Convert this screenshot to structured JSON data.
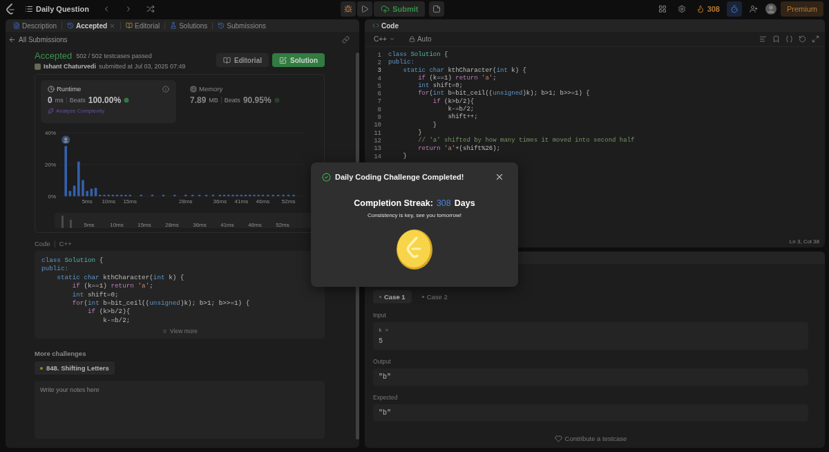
{
  "topbar": {
    "title": "Daily Question",
    "submit": "Submit",
    "streak": "308",
    "premium": "Premium"
  },
  "left_panel": {
    "tabs": [
      {
        "label": "Description",
        "selected": false,
        "closable": false,
        "kind": "description"
      },
      {
        "label": "Accepted",
        "selected": true,
        "closable": true,
        "kind": "accepted"
      },
      {
        "label": "Editorial",
        "selected": false,
        "closable": false,
        "kind": "editorial"
      },
      {
        "label": "Solutions",
        "selected": false,
        "closable": false,
        "kind": "solutions"
      },
      {
        "label": "Submissions",
        "selected": false,
        "closable": false,
        "kind": "submissions"
      }
    ],
    "back_link": "All Submissions",
    "result": {
      "status": "Accepted",
      "testcases": "502 / 502 testcases passed",
      "author": "Ishant Chaturvedi",
      "submitted": "submitted at Jul 03, 2025 07:49"
    },
    "buttons": [
      {
        "label": "Editorial",
        "kind": "secondary"
      },
      {
        "label": "Solution",
        "kind": "primary"
      }
    ],
    "metrics": [
      {
        "title": "Runtime",
        "kind": "runtime",
        "value": "0",
        "unit": "ms",
        "beats_label": "Beats",
        "beats": "100.00%",
        "selected": true
      },
      {
        "title": "Memory",
        "kind": "memory",
        "value": "7.89",
        "unit": "MB",
        "beats_label": "Beats",
        "beats": "90.95%",
        "selected": false
      }
    ],
    "analyze": "Analyze Complexity",
    "chart_data": {
      "type": "bar",
      "x": [
        0,
        1,
        2,
        3,
        4,
        5,
        6,
        7,
        8,
        9,
        10,
        11,
        12,
        13,
        14,
        15,
        17.6,
        20.2,
        22.8,
        25.4,
        28,
        29.6,
        31.2,
        32.8,
        34.4,
        36,
        37,
        38,
        39,
        40,
        41,
        42,
        43,
        44,
        45,
        46,
        47.2,
        48.4,
        49.6,
        50.8,
        52,
        53.2
      ],
      "series": [
        {
          "color": "#3b6fc4",
          "values": [
            31.6,
            3.4,
            6.7,
            21.8,
            10.2,
            3.4,
            4.8,
            5.3,
            1,
            1,
            1,
            1,
            1,
            1,
            1,
            1,
            1,
            1,
            1,
            1,
            1,
            1,
            1,
            1,
            1,
            1,
            1,
            1,
            1,
            1,
            1,
            1,
            1,
            1,
            1,
            1,
            1,
            1,
            1,
            1,
            1,
            1
          ]
        }
      ],
      "xlim": [
        -1,
        54
      ],
      "ylim": [
        0,
        40
      ],
      "yticks": [
        {
          "value": 0,
          "label": "0%"
        },
        {
          "value": 20,
          "label": "20%"
        },
        {
          "value": 40,
          "label": "40%"
        }
      ],
      "xticks": [
        {
          "value": 5,
          "label": "5ms"
        },
        {
          "value": 10,
          "label": "10ms"
        },
        {
          "value": 15,
          "label": "15ms"
        },
        {
          "value": 28,
          "label": "28ms"
        },
        {
          "value": 36,
          "label": "36ms"
        },
        {
          "value": 41,
          "label": "41ms"
        },
        {
          "value": 46,
          "label": "46ms"
        },
        {
          "value": 52,
          "label": "52ms"
        }
      ]
    },
    "overview_labels": [
      "5ms",
      "10ms",
      "15ms",
      "28ms",
      "36ms",
      "41ms",
      "46ms",
      "52ms"
    ],
    "code_section": {
      "label": "Code",
      "language": "C++",
      "view_more": "View more",
      "lines": [
        [
          {
            "text": "class ",
            "kind": "keyword"
          },
          {
            "text": "Solution",
            "kind": "class"
          },
          {
            "text": " {",
            "kind": "plain"
          }
        ],
        [
          {
            "text": "public:",
            "kind": "keyword"
          }
        ],
        [
          {
            "text": "    static char ",
            "kind": "keyword"
          },
          {
            "text": "kthCharacter(",
            "kind": "plain"
          },
          {
            "text": "int",
            "kind": "keyword"
          },
          {
            "text": " k) {",
            "kind": "plain"
          }
        ],
        [
          {
            "text": "        if ",
            "kind": "control"
          },
          {
            "text": "(k==1) ",
            "kind": "plain"
          },
          {
            "text": "return ",
            "kind": "control"
          },
          {
            "text": "'a'",
            "kind": "string"
          },
          {
            "text": ";",
            "kind": "plain"
          }
        ],
        [
          {
            "text": "        int ",
            "kind": "keyword"
          },
          {
            "text": "shift=0;",
            "kind": "plain"
          }
        ],
        [
          {
            "text": "        for",
            "kind": "control"
          },
          {
            "text": "(",
            "kind": "plain"
          },
          {
            "text": "int ",
            "kind": "keyword"
          },
          {
            "text": "b=bit_ceil((",
            "kind": "plain"
          },
          {
            "text": "unsigned",
            "kind": "keyword"
          },
          {
            "text": ")k); b>1; b>>=1) {",
            "kind": "plain"
          }
        ],
        [
          {
            "text": "            if ",
            "kind": "control"
          },
          {
            "text": "(k>b/2){",
            "kind": "plain"
          }
        ],
        [
          {
            "text": "                k-=b/2;",
            "kind": "plain"
          }
        ]
      ]
    },
    "more_challenges": {
      "title": "More challenges",
      "items": [
        "848. Shifting Letters"
      ]
    },
    "notes": {
      "placeholder": "Write your notes here"
    }
  },
  "editor": {
    "title": "Code",
    "language": "C++",
    "mode": "Auto",
    "status": "Ln 3, Col 38",
    "lines": [
      {
        "number": "1",
        "current": false,
        "tokens": [
          {
            "text": "class ",
            "kind": "keyword"
          },
          {
            "text": "Solution",
            "kind": "class"
          },
          {
            "text": " {",
            "kind": "plain"
          }
        ]
      },
      {
        "number": "2",
        "current": false,
        "tokens": [
          {
            "text": "public:",
            "kind": "keyword"
          }
        ]
      },
      {
        "number": "3",
        "current": true,
        "tokens": [
          {
            "text": "    static char ",
            "kind": "keyword"
          },
          {
            "text": "kthCharacter(",
            "kind": "plain"
          },
          {
            "text": "int",
            "kind": "keyword"
          },
          {
            "text": " k) {",
            "kind": "plain"
          }
        ]
      },
      {
        "number": "4",
        "current": false,
        "tokens": [
          {
            "text": "        if ",
            "kind": "control"
          },
          {
            "text": "(k==1) ",
            "kind": "plain"
          },
          {
            "text": "return ",
            "kind": "control"
          },
          {
            "text": "'a'",
            "kind": "string"
          },
          {
            "text": ";",
            "kind": "plain"
          }
        ]
      },
      {
        "number": "5",
        "current": false,
        "tokens": [
          {
            "text": "        int ",
            "kind": "keyword"
          },
          {
            "text": "shift=0;",
            "kind": "plain"
          }
        ]
      },
      {
        "number": "6",
        "current": false,
        "tokens": [
          {
            "text": "        for",
            "kind": "control"
          },
          {
            "text": "(",
            "kind": "plain"
          },
          {
            "text": "int ",
            "kind": "keyword"
          },
          {
            "text": "b=bit_ceil((",
            "kind": "plain"
          },
          {
            "text": "unsigned",
            "kind": "keyword"
          },
          {
            "text": ")k); b>1; b>>=1) {",
            "kind": "plain"
          }
        ]
      },
      {
        "number": "7",
        "current": false,
        "tokens": [
          {
            "text": "            if ",
            "kind": "control"
          },
          {
            "text": "(k>b/2){",
            "kind": "plain"
          }
        ]
      },
      {
        "number": "8",
        "current": false,
        "tokens": [
          {
            "text": "                k-=b/2;",
            "kind": "plain"
          }
        ]
      },
      {
        "number": "9",
        "current": false,
        "tokens": [
          {
            "text": "                shift++;",
            "kind": "plain"
          }
        ]
      },
      {
        "number": "10",
        "current": false,
        "tokens": [
          {
            "text": "            }",
            "kind": "plain"
          }
        ]
      },
      {
        "number": "11",
        "current": false,
        "tokens": [
          {
            "text": "        }",
            "kind": "plain"
          }
        ]
      },
      {
        "number": "12",
        "current": false,
        "tokens": [
          {
            "text": "        // 'a' shifted by how many times it moved into second half",
            "kind": "comment"
          }
        ]
      },
      {
        "number": "13",
        "current": false,
        "tokens": [
          {
            "text": "        return ",
            "kind": "control"
          },
          {
            "text": "'a'",
            "kind": "string"
          },
          {
            "text": "+(shift%26);",
            "kind": "plain"
          }
        ]
      },
      {
        "number": "14",
        "current": false,
        "tokens": [
          {
            "text": "    }",
            "kind": "plain"
          }
        ]
      }
    ]
  },
  "testcase": {
    "cases": [
      {
        "label": "Case 1",
        "selected": true
      },
      {
        "label": "Case 2",
        "selected": false
      }
    ],
    "fields": [
      {
        "label": "Input",
        "name": "k =",
        "value": "5"
      },
      {
        "label": "Output",
        "value": "\"b\""
      },
      {
        "label": "Expected",
        "value": "\"b\""
      }
    ],
    "contribute": "Contribute a testcase"
  },
  "modal": {
    "title": "Daily Coding Challenge Completed!",
    "streak_label": "Completion Streak:",
    "streak_value": "308",
    "streak_unit": "Days",
    "message": "Consistency is key, see you tomorrow!"
  }
}
